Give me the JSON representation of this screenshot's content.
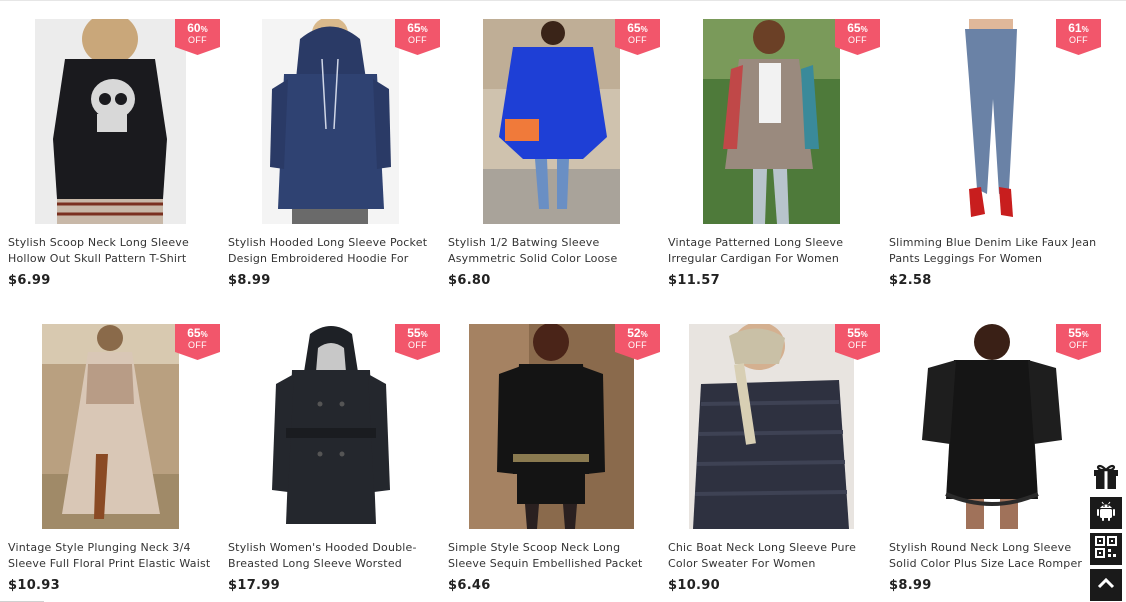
{
  "products": [
    {
      "title": "Stylish Scoop Neck Long Sleeve Hollow Out Skull Pattern T-Shirt",
      "price": "$6.99",
      "discount": "60",
      "percent_sign": "%",
      "off": "OFF"
    },
    {
      "title": "Stylish Hooded Long Sleeve Pocket Design Embroidered Hoodie For",
      "price": "$8.99",
      "discount": "65",
      "percent_sign": "%",
      "off": "OFF"
    },
    {
      "title": "Stylish 1/2 Batwing Sleeve Asymmetric Solid Color Loose",
      "price": "$6.80",
      "discount": "65",
      "percent_sign": "%",
      "off": "OFF"
    },
    {
      "title": "Vintage Patterned Long Sleeve Irregular Cardigan For Women",
      "price": "$11.57",
      "discount": "65",
      "percent_sign": "%",
      "off": "OFF"
    },
    {
      "title": "Slimming Blue Denim Like Faux Jean Pants Leggings For Women",
      "price": "$2.58",
      "discount": "61",
      "percent_sign": "%",
      "off": "OFF"
    },
    {
      "title": "Vintage Style Plunging Neck 3/4 Sleeve Full Floral Print Elastic Waist",
      "price": "$10.93",
      "discount": "65",
      "percent_sign": "%",
      "off": "OFF"
    },
    {
      "title": "Stylish Women's Hooded Double-Breasted Long Sleeve Worsted",
      "price": "$17.99",
      "discount": "55",
      "percent_sign": "%",
      "off": "OFF"
    },
    {
      "title": "Simple Style Scoop Neck Long Sleeve Sequin Embellished Packet",
      "price": "$6.46",
      "discount": "52",
      "percent_sign": "%",
      "off": "OFF"
    },
    {
      "title": "Chic Boat Neck Long Sleeve Pure Color Sweater For Women",
      "price": "$10.90",
      "discount": "55",
      "percent_sign": "%",
      "off": "OFF"
    },
    {
      "title": "Stylish Round Neck Long Sleeve Solid Color Plus Size Lace Romper",
      "price": "$8.99",
      "discount": "55",
      "percent_sign": "%",
      "off": "OFF"
    }
  ],
  "side_tools": {
    "icons": [
      "gift-icon",
      "android-icon",
      "qr-code-icon",
      "back-to-top-icon"
    ]
  },
  "colors": {
    "badge": "#f2566b",
    "price": "#222222",
    "title": "#333333",
    "tool_dark": "#1a1a1a"
  }
}
